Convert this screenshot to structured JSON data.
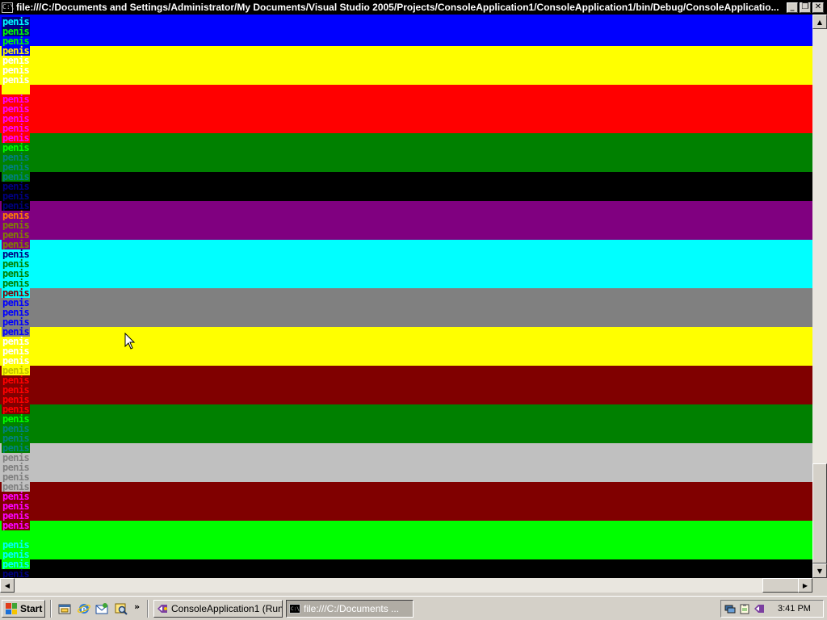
{
  "window": {
    "title": "file:///C:/Documents and Settings/Administrator/My Documents/Visual Studio 2005/Projects/ConsoleApplication1/ConsoleApplication1/bin/Debug/ConsoleApplicatio...",
    "icon_text": "C:\\",
    "minimize_glyph": "_",
    "maximize_glyph": "❐",
    "close_glyph": "✕"
  },
  "console": {
    "line_text": "penis",
    "bands": [
      {
        "color": "#0000ff"
      },
      {
        "color": "#ffff00"
      },
      {
        "color": "#ff0000"
      },
      {
        "color": "#008000"
      },
      {
        "color": "#000000"
      },
      {
        "color": "#800080"
      },
      {
        "color": "#00ffff"
      },
      {
        "color": "#808080"
      },
      {
        "color": "#ffff00"
      },
      {
        "color": "#800000"
      },
      {
        "color": "#008000"
      },
      {
        "color": "#c0c0c0"
      },
      {
        "color": "#800000"
      },
      {
        "color": "#00ff00"
      },
      {
        "color": "#000000"
      }
    ],
    "lines": [
      {
        "fg": "#00ffff",
        "bg": "#000080"
      },
      {
        "fg": "#00ff00",
        "bg": "#000080"
      },
      {
        "fg": "#00ff00",
        "bg": "#0000ff"
      },
      {
        "fg": "#ffff00",
        "bg": "#0000ff"
      },
      {
        "fg": "#ffffff",
        "bg": "#ffff00"
      },
      {
        "fg": "#ffffff",
        "bg": "#ffff00"
      },
      {
        "fg": "#ffffff",
        "bg": "#ffff00"
      },
      {
        "fg": "#ffff00",
        "bg": "#ffff00"
      },
      {
        "fg": "#ff00ff",
        "bg": "#ff0000"
      },
      {
        "fg": "#ff00ff",
        "bg": "#ff0000"
      },
      {
        "fg": "#ff00ff",
        "bg": "#ff0000"
      },
      {
        "fg": "#ff00ff",
        "bg": "#ff0000"
      },
      {
        "fg": "#ff00ff",
        "bg": "#ff0000"
      },
      {
        "fg": "#00ff00",
        "bg": "#008000"
      },
      {
        "fg": "#008080",
        "bg": "#008000"
      },
      {
        "fg": "#008080",
        "bg": "#008000"
      },
      {
        "fg": "#008080",
        "bg": "#008000"
      },
      {
        "fg": "#000080",
        "bg": "#000000"
      },
      {
        "fg": "#000080",
        "bg": "#000000"
      },
      {
        "fg": "#000080",
        "bg": "#000000"
      },
      {
        "fg": "#ff8000",
        "bg": "#800080"
      },
      {
        "fg": "#808000",
        "bg": "#800080"
      },
      {
        "fg": "#808000",
        "bg": "#800080"
      },
      {
        "fg": "#808000",
        "bg": "#800080"
      },
      {
        "fg": "#000080",
        "bg": "#00ffff"
      },
      {
        "fg": "#008000",
        "bg": "#00ffff"
      },
      {
        "fg": "#008000",
        "bg": "#00ffff"
      },
      {
        "fg": "#008000",
        "bg": "#00ffff"
      },
      {
        "fg": "#800000",
        "bg": "#00ffff"
      },
      {
        "fg": "#0000ff",
        "bg": "#808080"
      },
      {
        "fg": "#0000ff",
        "bg": "#808080"
      },
      {
        "fg": "#0000ff",
        "bg": "#808080"
      },
      {
        "fg": "#0000ff",
        "bg": "#808080"
      },
      {
        "fg": "#ffffff",
        "bg": "#ffff00"
      },
      {
        "fg": "#ffffff",
        "bg": "#ffff00"
      },
      {
        "fg": "#ffffff",
        "bg": "#ffff00"
      },
      {
        "fg": "#c0c000",
        "bg": "#ffff00"
      },
      {
        "fg": "#ff0000",
        "bg": "#800000"
      },
      {
        "fg": "#ff0000",
        "bg": "#800000"
      },
      {
        "fg": "#ff0000",
        "bg": "#800000"
      },
      {
        "fg": "#ff0000",
        "bg": "#800000"
      },
      {
        "fg": "#00ff00",
        "bg": "#008000"
      },
      {
        "fg": "#008080",
        "bg": "#008000"
      },
      {
        "fg": "#008080",
        "bg": "#008000"
      },
      {
        "fg": "#008080",
        "bg": "#008000"
      },
      {
        "fg": "#808080",
        "bg": "#c0c0c0"
      },
      {
        "fg": "#808080",
        "bg": "#c0c0c0"
      },
      {
        "fg": "#808080",
        "bg": "#c0c0c0"
      },
      {
        "fg": "#808080",
        "bg": "#c0c0c0"
      },
      {
        "fg": "#ff00ff",
        "bg": "#800000"
      },
      {
        "fg": "#ff00ff",
        "bg": "#800000"
      },
      {
        "fg": "#ff00ff",
        "bg": "#800000"
      },
      {
        "fg": "#ff00ff",
        "bg": "#800000"
      },
      {
        "fg": "#00ff00",
        "bg": "#00ff00"
      },
      {
        "fg": "#00ffff",
        "bg": "#00ff00"
      },
      {
        "fg": "#00ffff",
        "bg": "#00ff00"
      },
      {
        "fg": "#00ffff",
        "bg": "#00ff00"
      },
      {
        "fg": "#000080",
        "bg": "#000000"
      },
      {
        "fg": "#000080",
        "bg": "#000000"
      },
      {
        "fg": "#000080",
        "bg": "#000000"
      }
    ]
  },
  "scrollbars": {
    "up_glyph": "▲",
    "down_glyph": "▼",
    "left_glyph": "◀",
    "right_glyph": "▶"
  },
  "taskbar": {
    "start_label": "Start",
    "quicklaunch_icons": [
      "show-desktop-icon",
      "internet-explorer-icon",
      "outlook-express-icon",
      "search-icon"
    ],
    "chevron": "»",
    "tasks": [
      {
        "label": "ConsoleApplication1 (Run...",
        "icon": "visual-studio-icon",
        "active": false
      },
      {
        "label": "file:///C:/Documents ...",
        "icon": "console-icon",
        "active": true
      }
    ],
    "tray_icons": [
      "network-icon",
      "clipboard-icon",
      "visual-studio-tray-icon"
    ],
    "clock": "3:41 PM"
  }
}
